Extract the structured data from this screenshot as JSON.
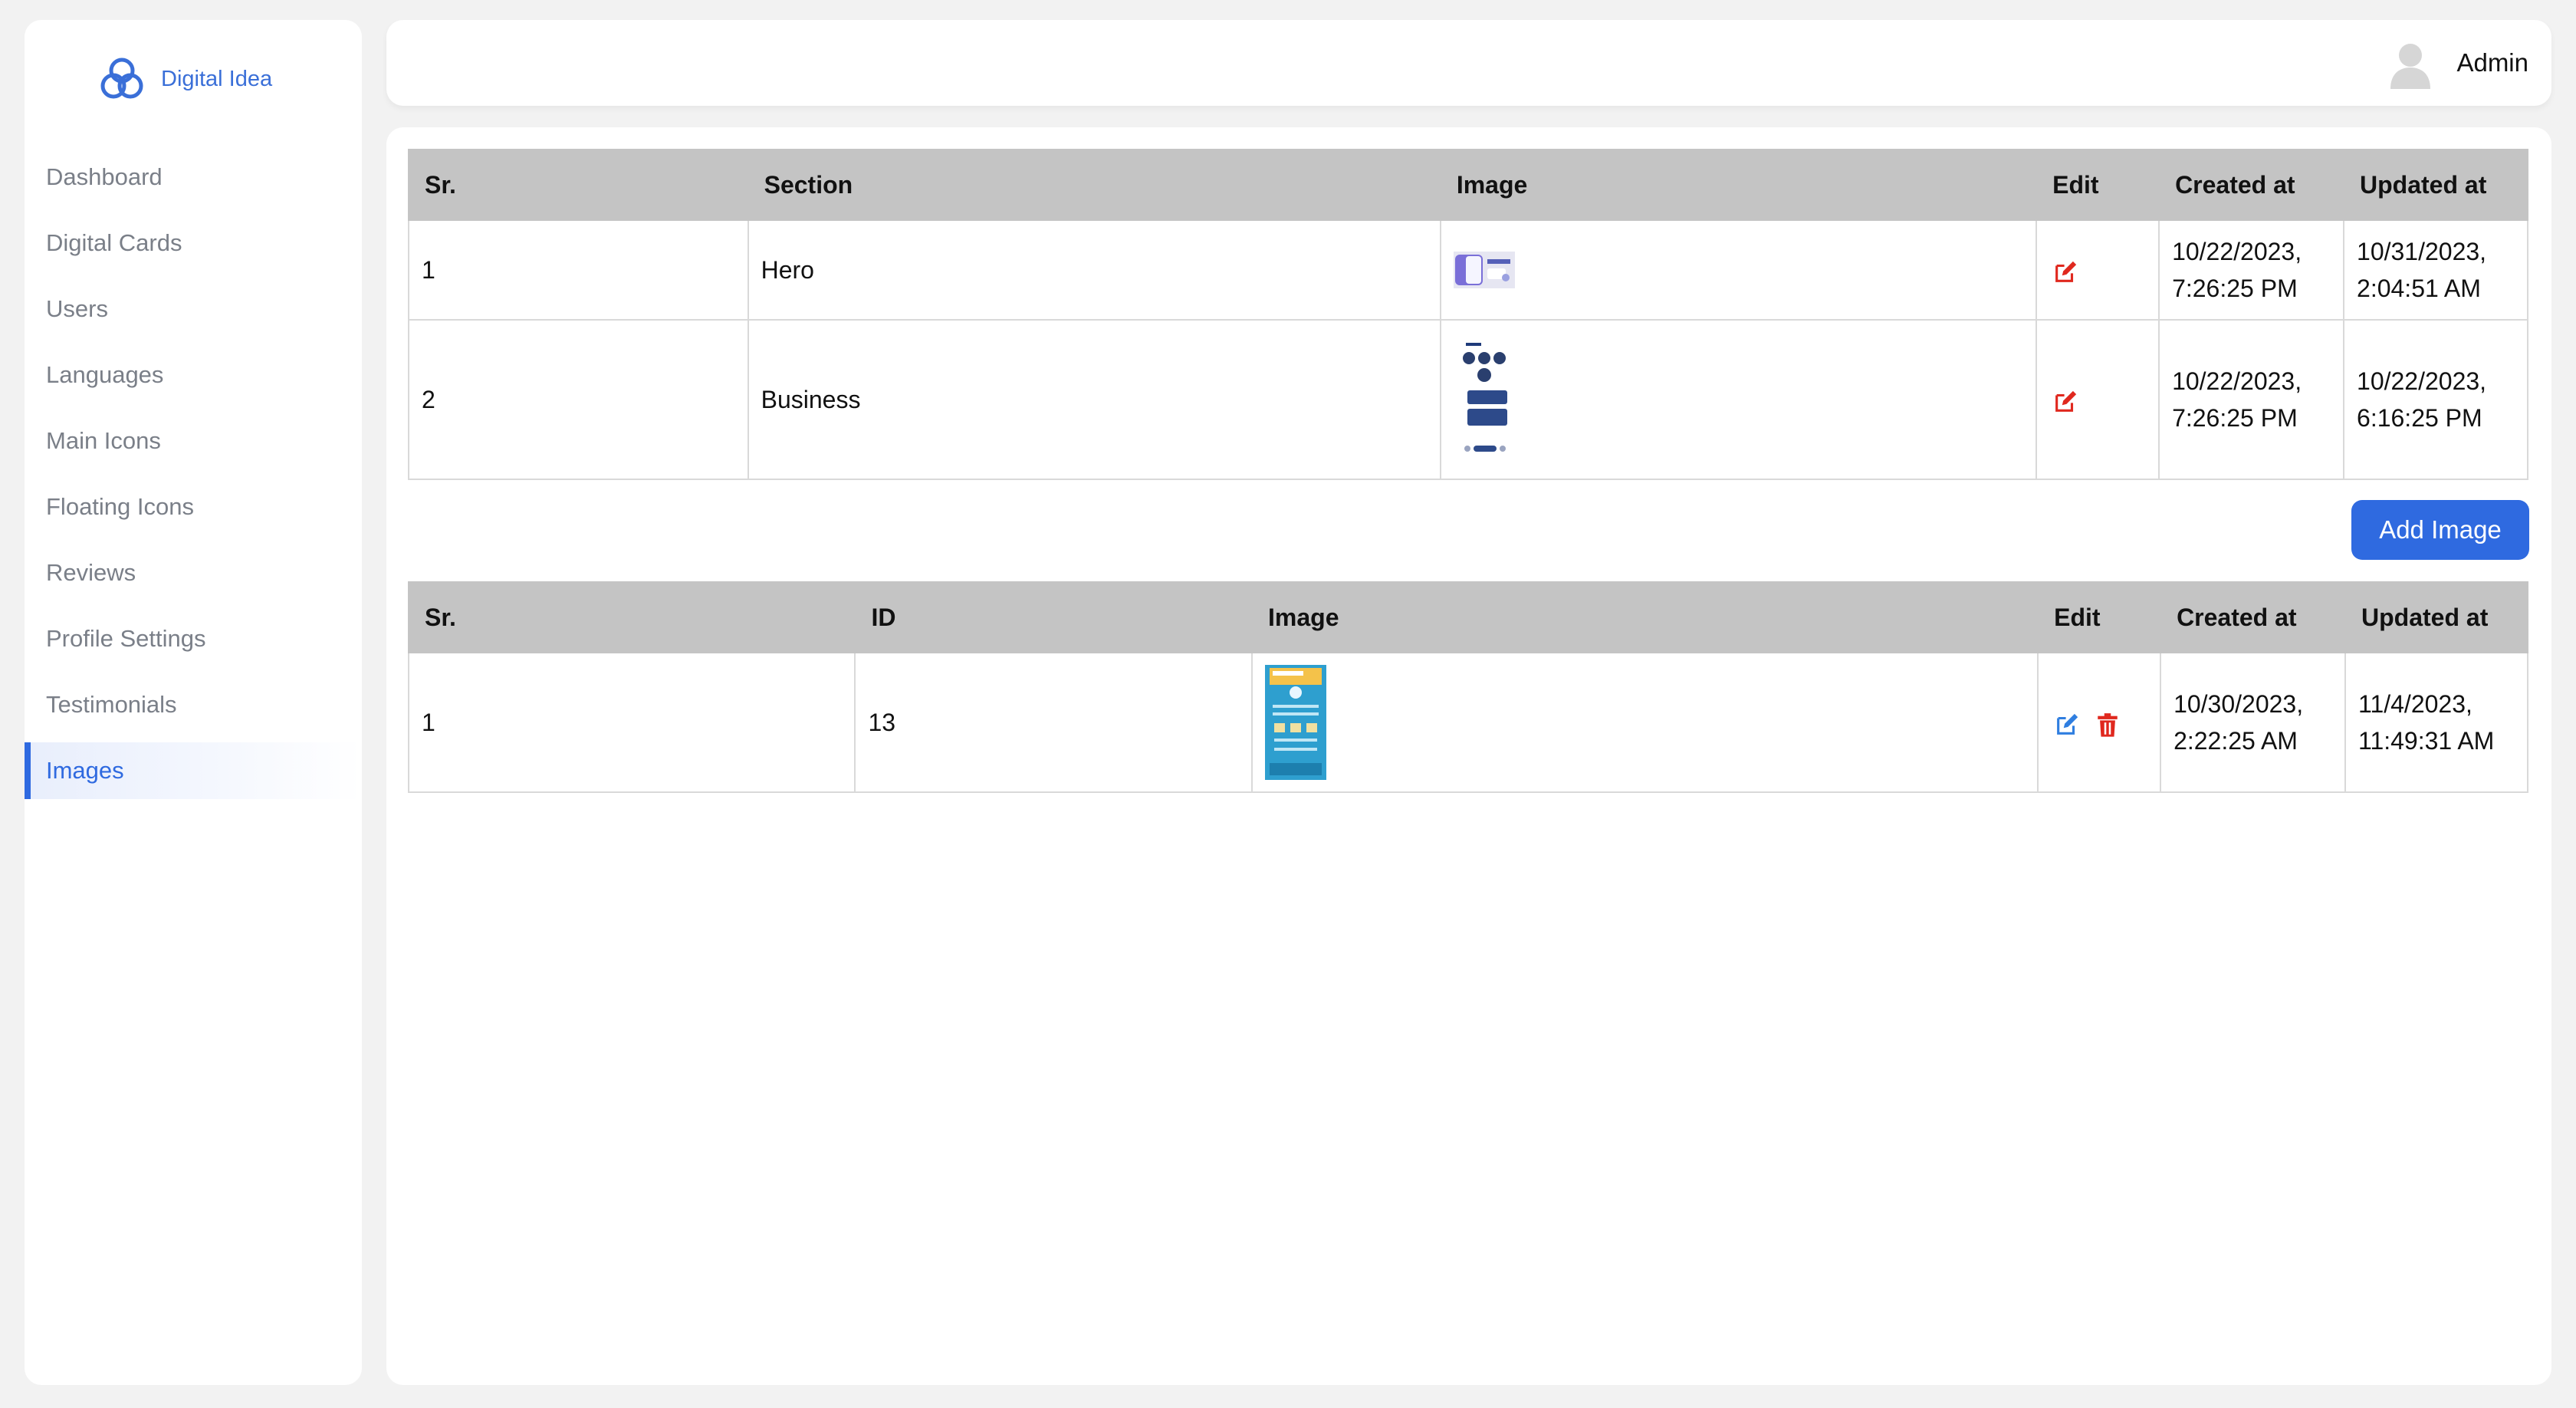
{
  "brand": {
    "name": "Digital Idea",
    "accent": "#3a6fd8"
  },
  "sidebar": {
    "items": [
      {
        "label": "Dashboard"
      },
      {
        "label": "Digital Cards"
      },
      {
        "label": "Users"
      },
      {
        "label": "Languages"
      },
      {
        "label": "Main Icons"
      },
      {
        "label": "Floating Icons"
      },
      {
        "label": "Reviews"
      },
      {
        "label": "Profile Settings"
      },
      {
        "label": "Testimonials"
      },
      {
        "label": "Images",
        "active": true
      }
    ]
  },
  "header": {
    "user_name": "Admin",
    "avatar_icon": "user-avatar-icon"
  },
  "sections_table": {
    "headers": [
      "Sr.",
      "Section",
      "Image",
      "Edit",
      "Created at",
      "Updated at"
    ],
    "rows": [
      {
        "sr": "1",
        "section": "Hero",
        "created_date": "10/22/2023,",
        "created_time": "7:26:25 PM",
        "updated_date": "10/31/2023,",
        "updated_time": "2:04:51 AM"
      },
      {
        "sr": "2",
        "section": "Business",
        "created_date": "10/22/2023,",
        "created_time": "7:26:25 PM",
        "updated_date": "10/22/2023,",
        "updated_time": "6:16:25 PM"
      }
    ]
  },
  "add_image_button": "Add Image",
  "images_table": {
    "headers": [
      "Sr.",
      "ID",
      "Image",
      "Edit",
      "Created at",
      "Updated at"
    ],
    "rows": [
      {
        "sr": "1",
        "id": "13",
        "created_date": "10/30/2023,",
        "created_time": "2:22:25 AM",
        "updated_date": "11/4/2023,",
        "updated_time": "11:49:31 AM"
      }
    ]
  },
  "colors": {
    "primary": "#2f6ae0",
    "danger": "#e0281e",
    "table_header": "#c4c4c4"
  }
}
